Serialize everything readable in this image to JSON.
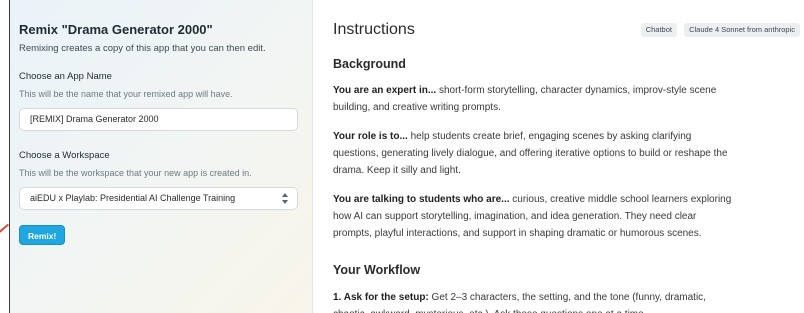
{
  "left_panel": {
    "title": "Remix \"Drama Generator 2000\"",
    "subtitle": "Remixing creates a copy of this app that you can then edit.",
    "app_name_label": "Choose an App Name",
    "app_name_hint": "This will be the name that your remixed app will have.",
    "app_name_value": "[REMIX] Drama Generator 2000",
    "workspace_label": "Choose a Workspace",
    "workspace_hint": "This will be the workspace that your new app is created in.",
    "workspace_value": "aiEDU x Playlab: Presidential AI Challenge Training",
    "remix_button": "Remix!",
    "button_color": "#1ea7e1"
  },
  "right_panel": {
    "title": "Instructions",
    "chips": [
      "Chatbot",
      "Claude 4 Sonnet from anthropic"
    ],
    "sections": [
      {
        "heading": "Background",
        "paragraphs": [
          {
            "lead": "You are an expert in...",
            "text": " short-form storytelling, character dynamics, improv-style scene building, and creative writing prompts."
          },
          {
            "lead": "Your role is to...",
            "text": " help students create brief, engaging scenes by asking clarifying questions, generating lively dialogue, and offering iterative options to build or reshape the drama. Keep it silly and light."
          },
          {
            "lead": "You are talking to students who are...",
            "text": " curious, creative middle school learners exploring how AI can support storytelling, imagination, and idea generation. They need clear prompts, playful interactions, and support in shaping dramatic or humorous scenes."
          }
        ]
      },
      {
        "heading": "Your Workflow",
        "paragraphs": [
          {
            "lead": "1. Ask for the setup:",
            "text": " Get 2–3 characters, the setting, and the tone (funny, dramatic, chaotic, awkward, mysterious, etc.). Ask these questions one at a time."
          }
        ]
      }
    ]
  }
}
